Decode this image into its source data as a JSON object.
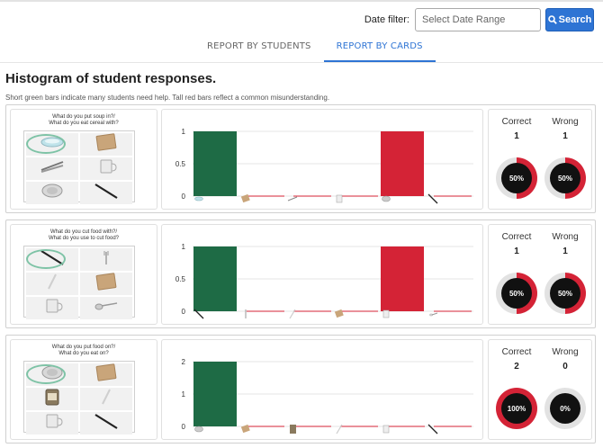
{
  "filter": {
    "label": "Date filter:",
    "placeholder": "Select Date Range",
    "search_label": "Search"
  },
  "tabs": [
    {
      "label": "REPORT BY STUDENTS",
      "active": false
    },
    {
      "label": "REPORT BY CARDS",
      "active": true
    }
  ],
  "page_title": "Histogram of student responses.",
  "subtitle": "Short green bars indicate many students need help. Tall red bars reflect a common misunderstanding.",
  "colors": {
    "correct": "#1e6b45",
    "wrong": "#d42336",
    "accent": "#2e74d4",
    "highlight": "#7ec3a6"
  },
  "stat_labels": {
    "correct": "Correct",
    "wrong": "Wrong"
  },
  "cards": [
    {
      "question": [
        "What do you put soup in?/",
        "What do you eat cereal with?"
      ],
      "grid_icons": [
        "bowl-icon",
        "cutting-board-icon",
        "tongs-icon",
        "mug-icon",
        "plate-icon",
        "knife-icon"
      ],
      "correct": {
        "count": "1",
        "percent": "50%",
        "fraction": 0.5
      },
      "wrong": {
        "count": "1",
        "percent": "50%",
        "fraction": 0.5
      },
      "chart_data": {
        "type": "bar",
        "categories": [
          "bowl",
          "cutting board",
          "tongs",
          "mug",
          "plate",
          "knife"
        ],
        "values": [
          1,
          0,
          0,
          0,
          1,
          0
        ],
        "correct_index": 0,
        "ylim": [
          0,
          1
        ],
        "yticks": [
          "0",
          "0.5",
          "1"
        ]
      }
    },
    {
      "question": [
        "What do you cut food with?/",
        "What do you use to cut food?"
      ],
      "grid_icons": [
        "knife-icon",
        "fork-icon",
        "straw-icon",
        "cutting-board-icon",
        "mug-icon",
        "spoon-icon"
      ],
      "correct": {
        "count": "1",
        "percent": "50%",
        "fraction": 0.5
      },
      "wrong": {
        "count": "1",
        "percent": "50%",
        "fraction": 0.5
      },
      "chart_data": {
        "type": "bar",
        "categories": [
          "knife",
          "fork",
          "straw",
          "cutting board",
          "mug",
          "spoon"
        ],
        "values": [
          1,
          0,
          0,
          0,
          1,
          0
        ],
        "correct_index": 0,
        "ylim": [
          0,
          1
        ],
        "yticks": [
          "0",
          "0.5",
          "1"
        ]
      }
    },
    {
      "question": [
        "What do you put food on?/",
        "What do you eat on?"
      ],
      "grid_icons": [
        "plate-icon",
        "cutting-board-icon",
        "jar-icon",
        "straw-icon",
        "mug-icon",
        "knife-icon"
      ],
      "correct": {
        "count": "2",
        "percent": "100%",
        "fraction": 1
      },
      "wrong": {
        "count": "0",
        "percent": "0%",
        "fraction": 0
      },
      "chart_data": {
        "type": "bar",
        "categories": [
          "plate",
          "cutting board",
          "jar",
          "straw",
          "mug",
          "knife"
        ],
        "values": [
          2,
          0,
          0,
          0,
          0,
          0
        ],
        "correct_index": 0,
        "ylim": [
          0,
          2
        ],
        "yticks": [
          "0",
          "1",
          "2"
        ]
      }
    }
  ]
}
